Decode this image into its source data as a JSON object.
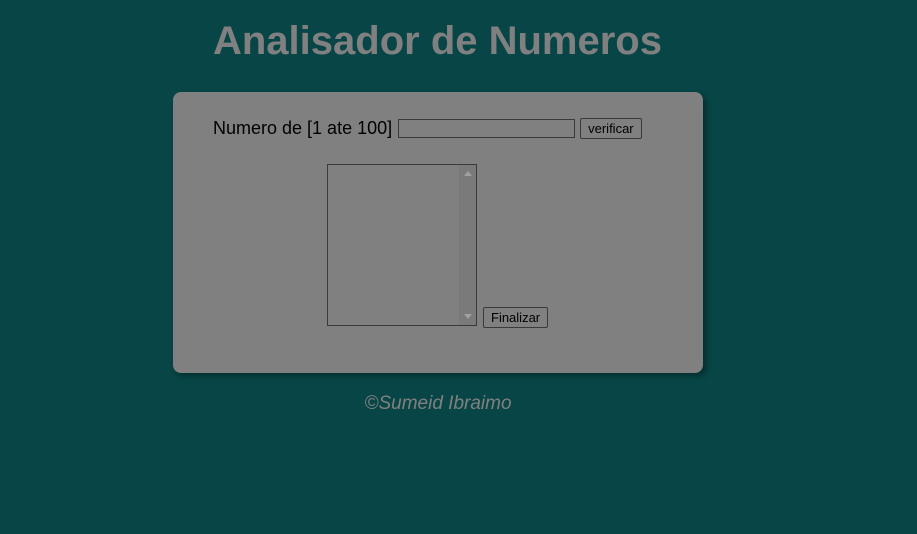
{
  "page": {
    "title": "Analisador de Numeros",
    "footer": "©Sumeid Ibraimo"
  },
  "form": {
    "number_label": "Numero de [1 ate 100]",
    "number_value": "",
    "verify_label": "verificar",
    "results_items": [],
    "finalize_label": "Finalizar"
  },
  "colors": {
    "background": "#074546",
    "card": "#808080",
    "title_text": "#808080"
  }
}
